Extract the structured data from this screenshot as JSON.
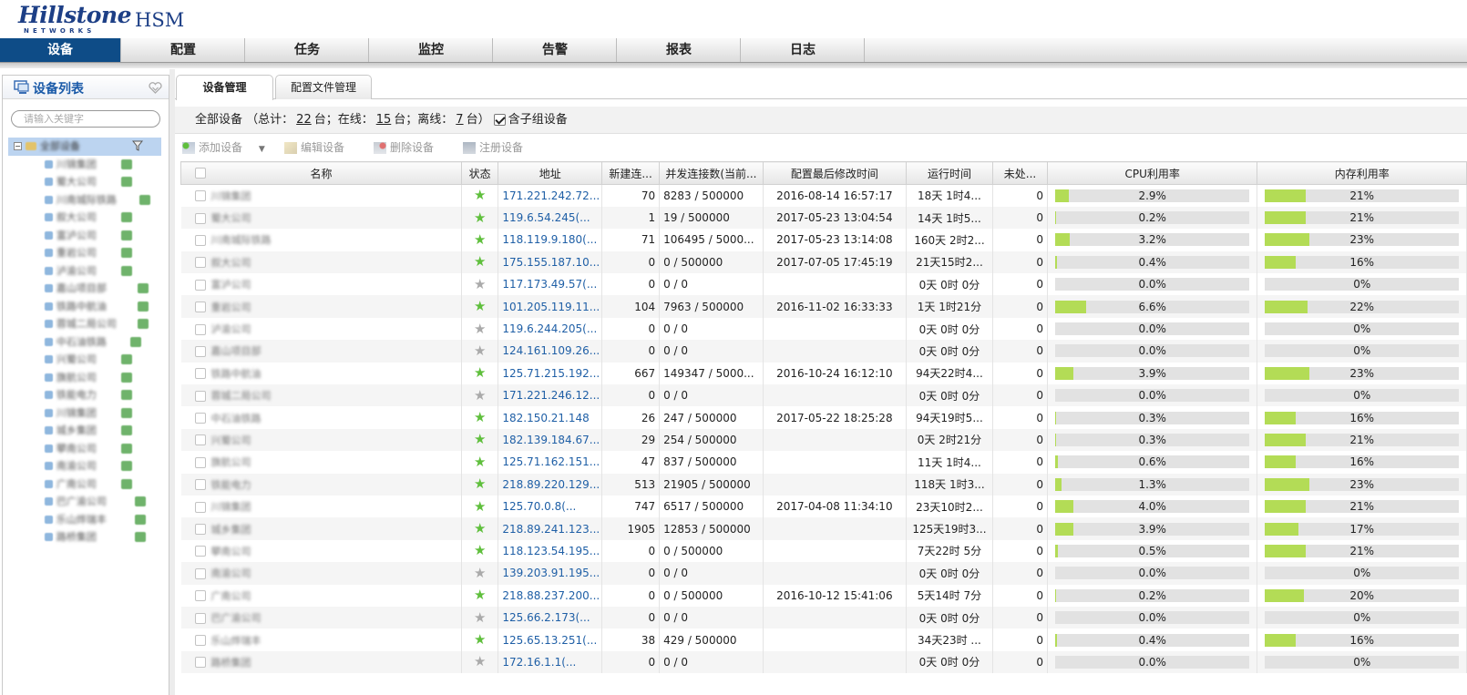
{
  "header": {
    "logo_text": "Hillstone",
    "logo_sub": "NETWORKS",
    "app_name": "HSM"
  },
  "nav": {
    "items": [
      {
        "label": "设备",
        "active": true
      },
      {
        "label": "配置",
        "active": false
      },
      {
        "label": "任务",
        "active": false
      },
      {
        "label": "监控",
        "active": false
      },
      {
        "label": "告警",
        "active": false
      },
      {
        "label": "报表",
        "active": false
      },
      {
        "label": "日志",
        "active": false
      }
    ]
  },
  "sidebar": {
    "title": "设备列表",
    "search_placeholder": "请输入关键字",
    "root_label": "全部设备",
    "items": [
      "川锦集团",
      "蜀大公司",
      "川南城际铁路",
      "叙大公司",
      "富泸公司",
      "重岩公司",
      "泸渝公司",
      "嘉山项目部",
      "铁路中航油",
      "蓉城二局公司",
      "中石油铁路",
      "兴蜀公司",
      "旗航公司",
      "铁能电力",
      "川锦集团",
      "城乡集团",
      "攀南公司",
      "南渝公司",
      "广南公司",
      "巴广渝公司",
      "乐山烨瑞丰",
      "路桥集团"
    ]
  },
  "tabs": [
    {
      "label": "设备管理",
      "active": true
    },
    {
      "label": "配置文件管理",
      "active": false
    }
  ],
  "summary": {
    "label": "全部设备",
    "total_label": "（总计：",
    "total": "22",
    "online_label": "台；在线：",
    "online": "15",
    "offline_label": "台；离线：",
    "offline": "7",
    "end_label": "台）",
    "include_sub_label": "含子组设备",
    "include_sub_checked": true
  },
  "toolbar": {
    "add": "添加设备",
    "edit": "编辑设备",
    "delete": "删除设备",
    "register": "注册设备"
  },
  "table": {
    "columns": [
      "名称",
      "状态",
      "地址",
      "新建连...",
      "并发连接数(当前...",
      "配置最后修改时间",
      "运行时间",
      "未处...",
      "CPU利用率",
      "内存利用率"
    ],
    "rows": [
      {
        "name": "川锦集团",
        "online": true,
        "ip": "171.221.242.72...",
        "new_conn": "70",
        "conc": "8283 / 500000",
        "modified": "2016-08-14 16:57:17",
        "uptime": "18天 1时4...",
        "unproc": "0",
        "cpu": 2.9,
        "cpu_text": "2.9%",
        "mem": 21,
        "mem_text": "21%"
      },
      {
        "name": "蜀大公司",
        "online": true,
        "ip": "119.6.54.245(...",
        "new_conn": "1",
        "conc": "19 / 500000",
        "modified": "2017-05-23 13:04:54",
        "uptime": "14天 1时5...",
        "unproc": "0",
        "cpu": 0.2,
        "cpu_text": "0.2%",
        "mem": 21,
        "mem_text": "21%"
      },
      {
        "name": "川南城际铁路",
        "online": true,
        "ip": "118.119.9.180(...",
        "new_conn": "71",
        "conc": "106495 / 5000...",
        "modified": "2017-05-23 13:14:08",
        "uptime": "160天 2时2...",
        "unproc": "0",
        "cpu": 3.2,
        "cpu_text": "3.2%",
        "mem": 23,
        "mem_text": "23%"
      },
      {
        "name": "叙大公司",
        "online": true,
        "ip": "175.155.187.10...",
        "new_conn": "0",
        "conc": "0 / 500000",
        "modified": "2017-07-05 17:45:19",
        "uptime": "21天15时2...",
        "unproc": "0",
        "cpu": 0.4,
        "cpu_text": "0.4%",
        "mem": 16,
        "mem_text": "16%"
      },
      {
        "name": "富泸公司",
        "online": false,
        "ip": "117.173.49.57(...",
        "new_conn": "0",
        "conc": "0 / 0",
        "modified": "",
        "uptime": "0天 0时 0分",
        "unproc": "0",
        "cpu": 0,
        "cpu_text": "0.0%",
        "mem": 0,
        "mem_text": "0%"
      },
      {
        "name": "重岩公司",
        "online": true,
        "ip": "101.205.119.11...",
        "new_conn": "104",
        "conc": "7963 / 500000",
        "modified": "2016-11-02 16:33:33",
        "uptime": "1天 1时21分",
        "unproc": "0",
        "cpu": 6.6,
        "cpu_text": "6.6%",
        "mem": 22,
        "mem_text": "22%"
      },
      {
        "name": "泸渝公司",
        "online": false,
        "ip": "119.6.244.205(...",
        "new_conn": "0",
        "conc": "0 / 0",
        "modified": "",
        "uptime": "0天 0时 0分",
        "unproc": "0",
        "cpu": 0,
        "cpu_text": "0.0%",
        "mem": 0,
        "mem_text": "0%"
      },
      {
        "name": "嘉山项目部",
        "online": false,
        "ip": "124.161.109.26...",
        "new_conn": "0",
        "conc": "0 / 0",
        "modified": "",
        "uptime": "0天 0时 0分",
        "unproc": "0",
        "cpu": 0,
        "cpu_text": "0.0%",
        "mem": 0,
        "mem_text": "0%"
      },
      {
        "name": "铁路中航油",
        "online": true,
        "ip": "125.71.215.192...",
        "new_conn": "667",
        "conc": "149347 / 5000...",
        "modified": "2016-10-24 16:12:10",
        "uptime": "94天22时4...",
        "unproc": "0",
        "cpu": 3.9,
        "cpu_text": "3.9%",
        "mem": 23,
        "mem_text": "23%"
      },
      {
        "name": "蓉城二局公司",
        "online": false,
        "ip": "171.221.246.12...",
        "new_conn": "0",
        "conc": "0 / 0",
        "modified": "",
        "uptime": "0天 0时 0分",
        "unproc": "0",
        "cpu": 0,
        "cpu_text": "0.0%",
        "mem": 0,
        "mem_text": "0%"
      },
      {
        "name": "中石油铁路",
        "online": true,
        "ip": "182.150.21.148",
        "new_conn": "26",
        "conc": "247 / 500000",
        "modified": "2017-05-22 18:25:28",
        "uptime": "94天19时5...",
        "unproc": "0",
        "cpu": 0.3,
        "cpu_text": "0.3%",
        "mem": 16,
        "mem_text": "16%"
      },
      {
        "name": "兴蜀公司",
        "online": true,
        "ip": "182.139.184.67...",
        "new_conn": "29",
        "conc": "254 / 500000",
        "modified": "",
        "uptime": "0天 2时21分",
        "unproc": "0",
        "cpu": 0.3,
        "cpu_text": "0.3%",
        "mem": 21,
        "mem_text": "21%"
      },
      {
        "name": "旗航公司",
        "online": true,
        "ip": "125.71.162.151...",
        "new_conn": "47",
        "conc": "837 / 500000",
        "modified": "",
        "uptime": "11天 1时4...",
        "unproc": "0",
        "cpu": 0.6,
        "cpu_text": "0.6%",
        "mem": 16,
        "mem_text": "16%"
      },
      {
        "name": "铁能电力",
        "online": true,
        "ip": "218.89.220.129...",
        "new_conn": "513",
        "conc": "21905 / 500000",
        "modified": "",
        "uptime": "118天 1时3...",
        "unproc": "0",
        "cpu": 1.3,
        "cpu_text": "1.3%",
        "mem": 23,
        "mem_text": "23%"
      },
      {
        "name": "川锦集团",
        "online": true,
        "ip": "125.70.0.8(...",
        "new_conn": "747",
        "conc": "6517 / 500000",
        "modified": "2017-04-08 11:34:10",
        "uptime": "23天10时2...",
        "unproc": "0",
        "cpu": 4.0,
        "cpu_text": "4.0%",
        "mem": 21,
        "mem_text": "21%"
      },
      {
        "name": "城乡集团",
        "online": true,
        "ip": "218.89.241.123...",
        "new_conn": "1905",
        "conc": "12853 / 500000",
        "modified": "",
        "uptime": "125天19时3...",
        "unproc": "0",
        "cpu": 3.9,
        "cpu_text": "3.9%",
        "mem": 17,
        "mem_text": "17%"
      },
      {
        "name": "攀南公司",
        "online": true,
        "ip": "118.123.54.195...",
        "new_conn": "0",
        "conc": "0 / 500000",
        "modified": "",
        "uptime": "7天22时 5分",
        "unproc": "0",
        "cpu": 0.5,
        "cpu_text": "0.5%",
        "mem": 21,
        "mem_text": "21%"
      },
      {
        "name": "南渝公司",
        "online": false,
        "ip": "139.203.91.195...",
        "new_conn": "0",
        "conc": "0 / 0",
        "modified": "",
        "uptime": "0天 0时 0分",
        "unproc": "0",
        "cpu": 0,
        "cpu_text": "0.0%",
        "mem": 0,
        "mem_text": "0%"
      },
      {
        "name": "广南公司",
        "online": true,
        "ip": "218.88.237.200...",
        "new_conn": "0",
        "conc": "0 / 500000",
        "modified": "2016-10-12 15:41:06",
        "uptime": "5天14时 7分",
        "unproc": "0",
        "cpu": 0.2,
        "cpu_text": "0.2%",
        "mem": 20,
        "mem_text": "20%"
      },
      {
        "name": "巴广渝公司",
        "online": false,
        "ip": "125.66.2.173(...",
        "new_conn": "0",
        "conc": "0 / 0",
        "modified": "",
        "uptime": "0天 0时 0分",
        "unproc": "0",
        "cpu": 0,
        "cpu_text": "0.0%",
        "mem": 0,
        "mem_text": "0%"
      },
      {
        "name": "乐山烨瑞丰",
        "online": true,
        "ip": "125.65.13.251(...",
        "new_conn": "38",
        "conc": "429 / 500000",
        "modified": "",
        "uptime": "34天23时 ...",
        "unproc": "0",
        "cpu": 0.4,
        "cpu_text": "0.4%",
        "mem": 16,
        "mem_text": "16%"
      },
      {
        "name": "路桥集团",
        "online": false,
        "ip": "172.16.1.1(...",
        "new_conn": "0",
        "conc": "0 / 0",
        "modified": "",
        "uptime": "0天 0时 0分",
        "unproc": "0",
        "cpu": 0,
        "cpu_text": "0.0%",
        "mem": 0,
        "mem_text": "0%"
      }
    ]
  },
  "colors": {
    "nav_active": "#0e4c87",
    "brand": "#1d3f86",
    "link": "#1f5fa6",
    "bar_fill": "#b3dc56",
    "star_online": "#5fbf3c",
    "star_offline": "#aaaaaa"
  },
  "icons": [
    "monitor-icon",
    "collapse-heart-icon",
    "folder-icon",
    "filter-icon",
    "device-icon",
    "online-star-icon",
    "offline-star-icon",
    "add-icon",
    "edit-icon",
    "delete-icon",
    "register-icon"
  ]
}
